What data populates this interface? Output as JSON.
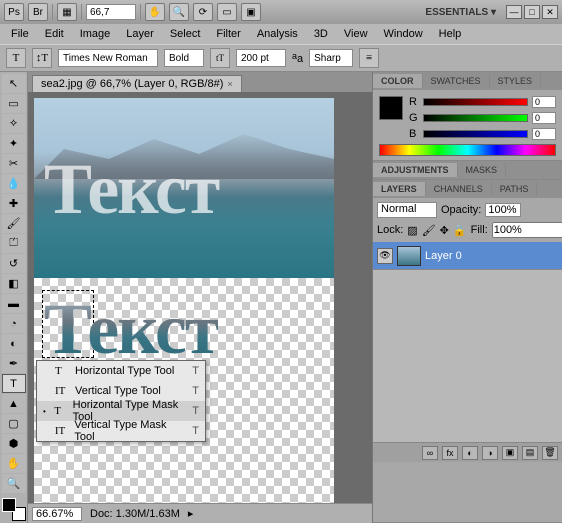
{
  "titlebar": {
    "zoom": "66,7",
    "workspace": "ESSENTIALS ▾"
  },
  "menu": [
    "File",
    "Edit",
    "Image",
    "Layer",
    "Select",
    "Filter",
    "Analysis",
    "3D",
    "View",
    "Window",
    "Help"
  ],
  "optbar": {
    "font": "Times New Roman",
    "weight": "Bold",
    "size_label": "200 pt",
    "aa": "Sharp"
  },
  "doctab": {
    "title": "sea2.jpg @ 66,7% (Layer 0, RGB/8#)",
    "close": "×"
  },
  "canvas": {
    "maintext": "Текст",
    "masktext": "Текст"
  },
  "type_flyout": [
    {
      "icon": "T",
      "label": "Horizontal Type Tool",
      "key": "T",
      "sel": false
    },
    {
      "icon": "IT",
      "label": "Vertical Type Tool",
      "key": "T",
      "sel": false
    },
    {
      "icon": "T",
      "label": "Horizontal Type Mask Tool",
      "key": "T",
      "sel": true
    },
    {
      "icon": "IT",
      "label": "Vertical Type Mask Tool",
      "key": "T",
      "sel": false
    }
  ],
  "status": {
    "zoom": "66.67%",
    "docinfo": "Doc: 1.30M/1.63M"
  },
  "panels": {
    "color": {
      "tabs": [
        "COLOR",
        "SWATCHES",
        "STYLES"
      ],
      "r": "0",
      "g": "0",
      "b": "0"
    },
    "adj": {
      "tabs": [
        "ADJUSTMENTS",
        "MASKS"
      ]
    },
    "layers": {
      "tabs": [
        "LAYERS",
        "CHANNELS",
        "PATHS"
      ],
      "blend": "Normal",
      "opacity_label": "Opacity:",
      "opacity": "100%",
      "lock_label": "Lock:",
      "fill_label": "Fill:",
      "fill": "100%",
      "items": [
        {
          "name": "Layer 0"
        }
      ]
    }
  }
}
